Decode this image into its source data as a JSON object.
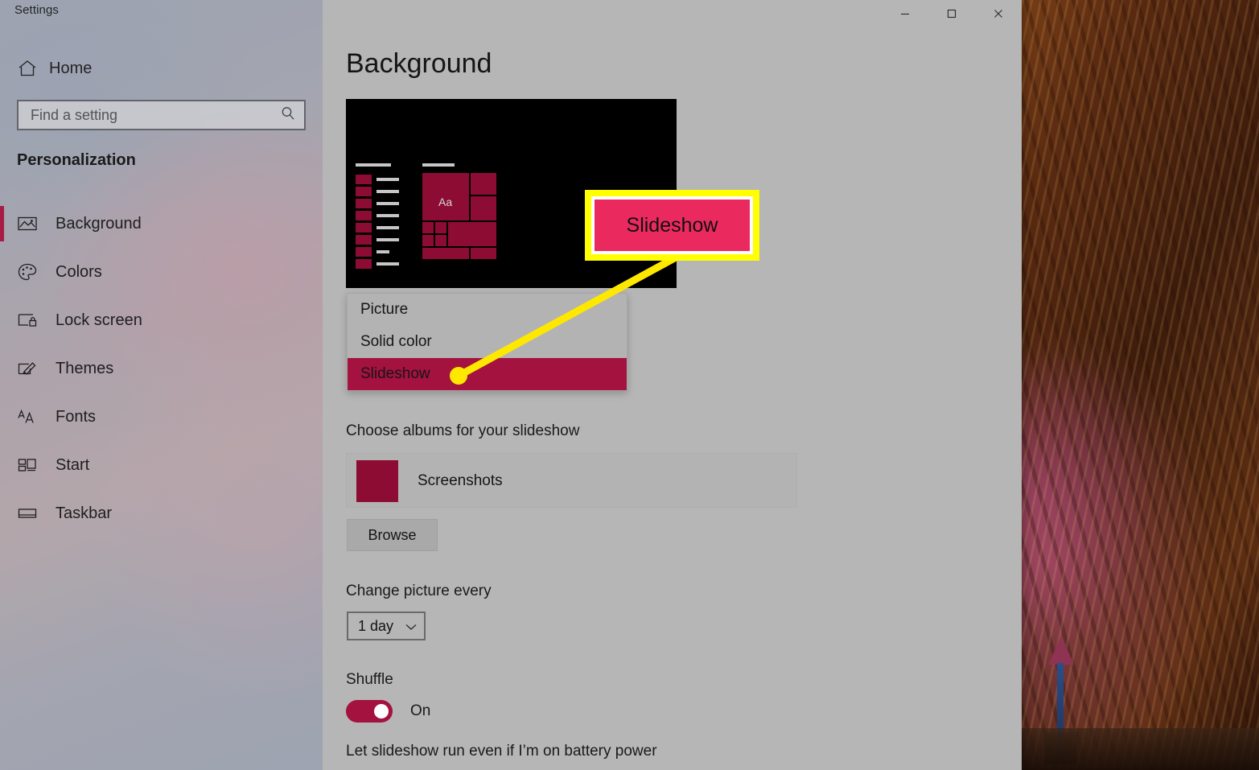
{
  "window": {
    "title": "Settings",
    "controls": [
      {
        "name": "minimize",
        "glyph": "minimize-icon"
      },
      {
        "name": "maximize",
        "glyph": "maximize-icon"
      },
      {
        "name": "close",
        "glyph": "close-icon"
      }
    ]
  },
  "sidebar": {
    "home_label": "Home",
    "home_icon": "home-icon",
    "search": {
      "placeholder": "Find a setting",
      "value": "",
      "icon": "search-icon"
    },
    "section_title": "Personalization",
    "items": [
      {
        "label": "Background",
        "icon": "image-icon",
        "selected": true
      },
      {
        "label": "Colors",
        "icon": "palette-icon",
        "selected": false
      },
      {
        "label": "Lock screen",
        "icon": "lock-screen-icon",
        "selected": false
      },
      {
        "label": "Themes",
        "icon": "brush-icon",
        "selected": false
      },
      {
        "label": "Fonts",
        "icon": "fonts-icon",
        "selected": false
      },
      {
        "label": "Start",
        "icon": "start-icon",
        "selected": false
      },
      {
        "label": "Taskbar",
        "icon": "taskbar-icon",
        "selected": false
      }
    ]
  },
  "main": {
    "page_title": "Background",
    "preview_alt": "desktop-preview",
    "preview_tile_text": "Aa",
    "background_dropdown": {
      "options": [
        "Picture",
        "Solid color",
        "Slideshow"
      ],
      "selected": "Slideshow"
    },
    "albums": {
      "label": "Choose albums for your slideshow",
      "entries": [
        {
          "name": "Screenshots"
        }
      ],
      "browse_label": "Browse"
    },
    "interval": {
      "label": "Change picture every",
      "value": "1 day"
    },
    "shuffle": {
      "label": "Shuffle",
      "state": "On"
    },
    "battery": {
      "label": "Let slideshow run even if I’m on battery power"
    }
  },
  "annotation": {
    "callout_text": "Slideshow",
    "highlight_color": "#ffff00",
    "callout_fill": "#ea2a5e"
  },
  "colors": {
    "accent": "#a4123f",
    "content_bg": "#b6b6b6",
    "highlight": "#ffff00"
  }
}
